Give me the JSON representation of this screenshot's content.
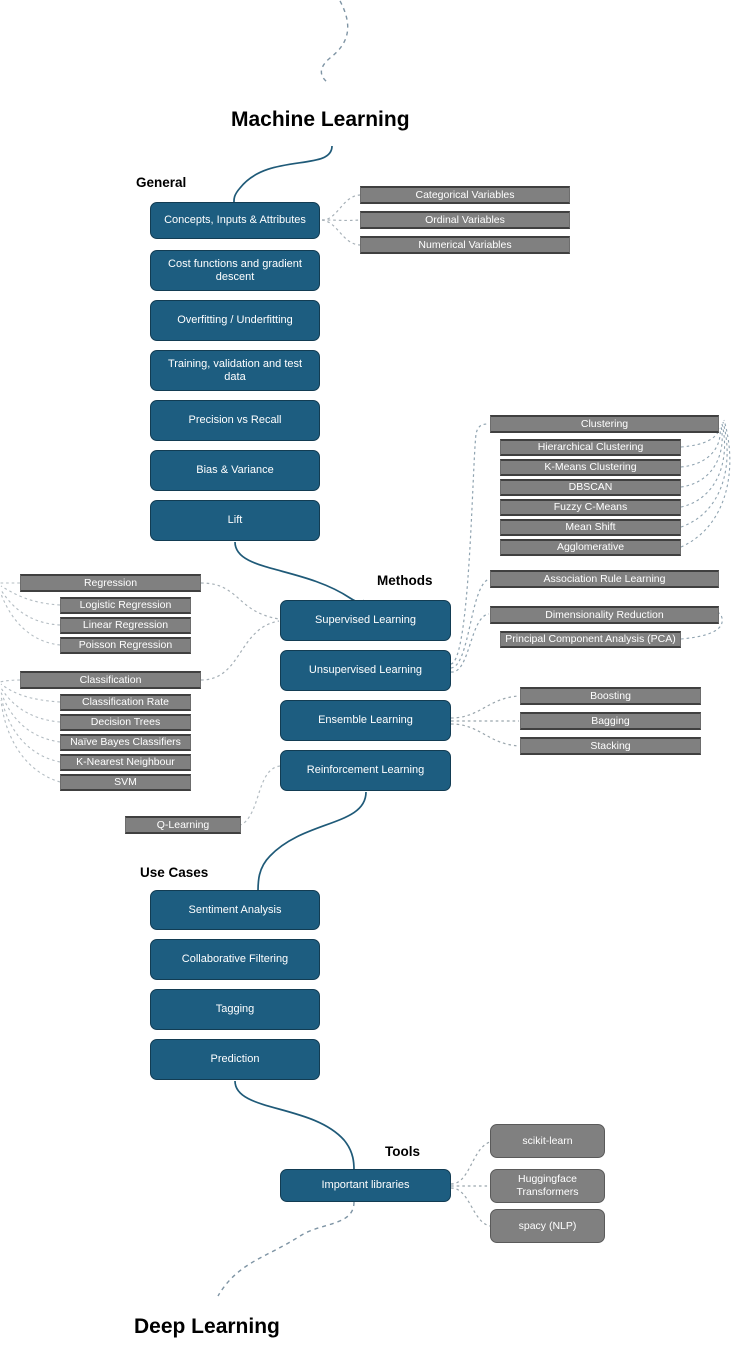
{
  "titles": {
    "top": "Machine Learning",
    "bottom": "Deep Learning"
  },
  "sections": {
    "general": "General",
    "methods": "Methods",
    "use_cases": "Use Cases",
    "tools": "Tools"
  },
  "general_nodes": [
    {
      "label": "Concepts, Inputs & Attributes"
    },
    {
      "label": "Cost functions and gradient descent"
    },
    {
      "label": "Overfitting / Underfitting"
    },
    {
      "label": "Training, validation and test data"
    },
    {
      "label": "Precision vs Recall"
    },
    {
      "label": "Bias & Variance"
    },
    {
      "label": "Lift"
    }
  ],
  "variable_types": [
    {
      "label": "Categorical Variables"
    },
    {
      "label": "Ordinal Variables"
    },
    {
      "label": "Numerical Variables"
    }
  ],
  "methods_nodes": [
    {
      "label": "Supervised Learning"
    },
    {
      "label": "Unsupervised Learning"
    },
    {
      "label": "Ensemble Learning"
    },
    {
      "label": "Reinforcement Learning"
    }
  ],
  "supervised": {
    "regression": {
      "label": "Regression",
      "children": [
        {
          "label": "Logistic Regression"
        },
        {
          "label": "Linear Regression"
        },
        {
          "label": "Poisson Regression"
        }
      ]
    },
    "classification": {
      "label": "Classification",
      "children": [
        {
          "label": "Classification Rate"
        },
        {
          "label": "Decision Trees"
        },
        {
          "label": "Naïve Bayes Classifiers"
        },
        {
          "label": "K-Nearest Neighbour"
        },
        {
          "label": "SVM"
        }
      ]
    }
  },
  "unsupervised": {
    "clustering": {
      "label": "Clustering",
      "children": [
        {
          "label": "Hierarchical Clustering"
        },
        {
          "label": "K-Means Clustering"
        },
        {
          "label": "DBSCAN"
        },
        {
          "label": "Fuzzy C-Means"
        },
        {
          "label": "Mean Shift"
        },
        {
          "label": "Agglomerative"
        }
      ]
    },
    "association_rule_learning": {
      "label": "Association Rule Learning"
    },
    "dimensionality_reduction": {
      "label": "Dimensionality Reduction",
      "children": [
        {
          "label": "Principal Component Analysis (PCA)"
        }
      ]
    }
  },
  "ensemble_children": [
    {
      "label": "Boosting"
    },
    {
      "label": "Bagging"
    },
    {
      "label": "Stacking"
    }
  ],
  "reinforcement_children": [
    {
      "label": "Q-Learning"
    }
  ],
  "use_case_nodes": [
    {
      "label": "Sentiment Analysis"
    },
    {
      "label": "Collaborative Filtering"
    },
    {
      "label": "Tagging"
    },
    {
      "label": "Prediction"
    }
  ],
  "tools_nodes": [
    {
      "label": "Important libraries"
    }
  ],
  "tools_children": [
    {
      "label": "scikit-learn"
    },
    {
      "label": "Huggingface Transformers"
    },
    {
      "label": "spacy (NLP)"
    }
  ],
  "colors": {
    "primary_node": "#1d5d80",
    "primary_border": "#123c53",
    "secondary_node": "#808080",
    "secondary_border": "#404040",
    "solid_edge": "#1f5a78",
    "dotted_edge": "#9aa6ad",
    "background": "#ffffff",
    "text_on_node": "#ffffff",
    "title_text": "#000000"
  }
}
